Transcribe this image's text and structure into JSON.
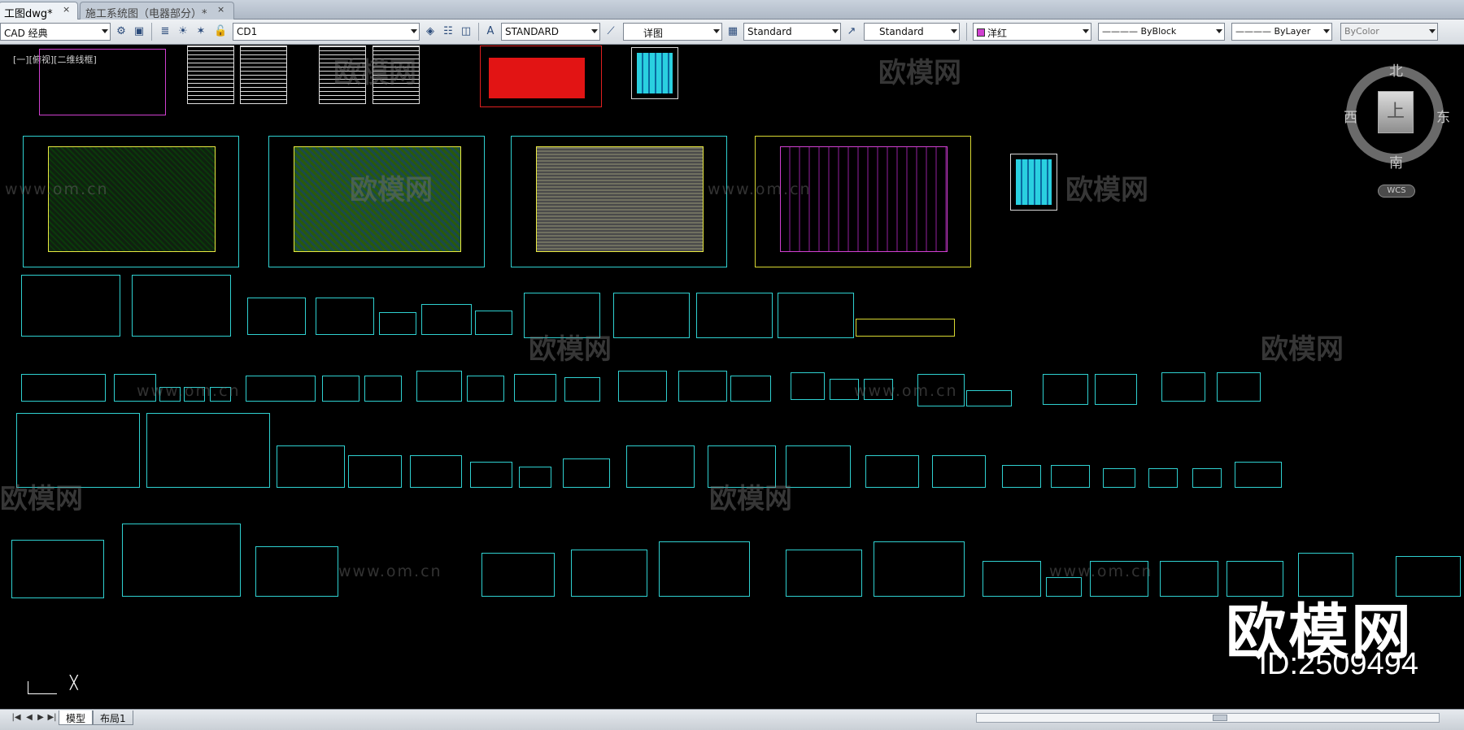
{
  "tabs": [
    {
      "label": "工图dwg*",
      "close": "×"
    },
    {
      "label": "施工系统图（电器部分）*",
      "close": "×"
    }
  ],
  "toolbar": {
    "workspace": "CAD 经典",
    "layer": "CD1",
    "text_style": "STANDARD",
    "dim_style": "详图",
    "table_style": "Standard",
    "mleader_style": "Standard",
    "color": "洋红",
    "linetype": "———— ByBlock",
    "lineweight": "———— ByLayer",
    "plotstyle": "ByColor"
  },
  "viewport": {
    "label": "[一][俯视][二维线框]"
  },
  "viewcube": {
    "north": "北",
    "south": "南",
    "east": "东",
    "west": "西",
    "top": "上",
    "wcs": "WCS"
  },
  "watermark": {
    "text": "欧模网",
    "url": "www.om.cn",
    "big": "欧模网",
    "id": "ID:2509494"
  },
  "layout_tabs": [
    {
      "label": "模型"
    },
    {
      "label": "布局1"
    }
  ],
  "nav_buttons": [
    "|◀",
    "◀",
    "▶",
    "▶|"
  ],
  "colors": {
    "cyan": "#2fd0d0",
    "yellow": "#d8d832",
    "magenta": "#d040d0",
    "red": "#e21414",
    "green": "#22c022"
  }
}
